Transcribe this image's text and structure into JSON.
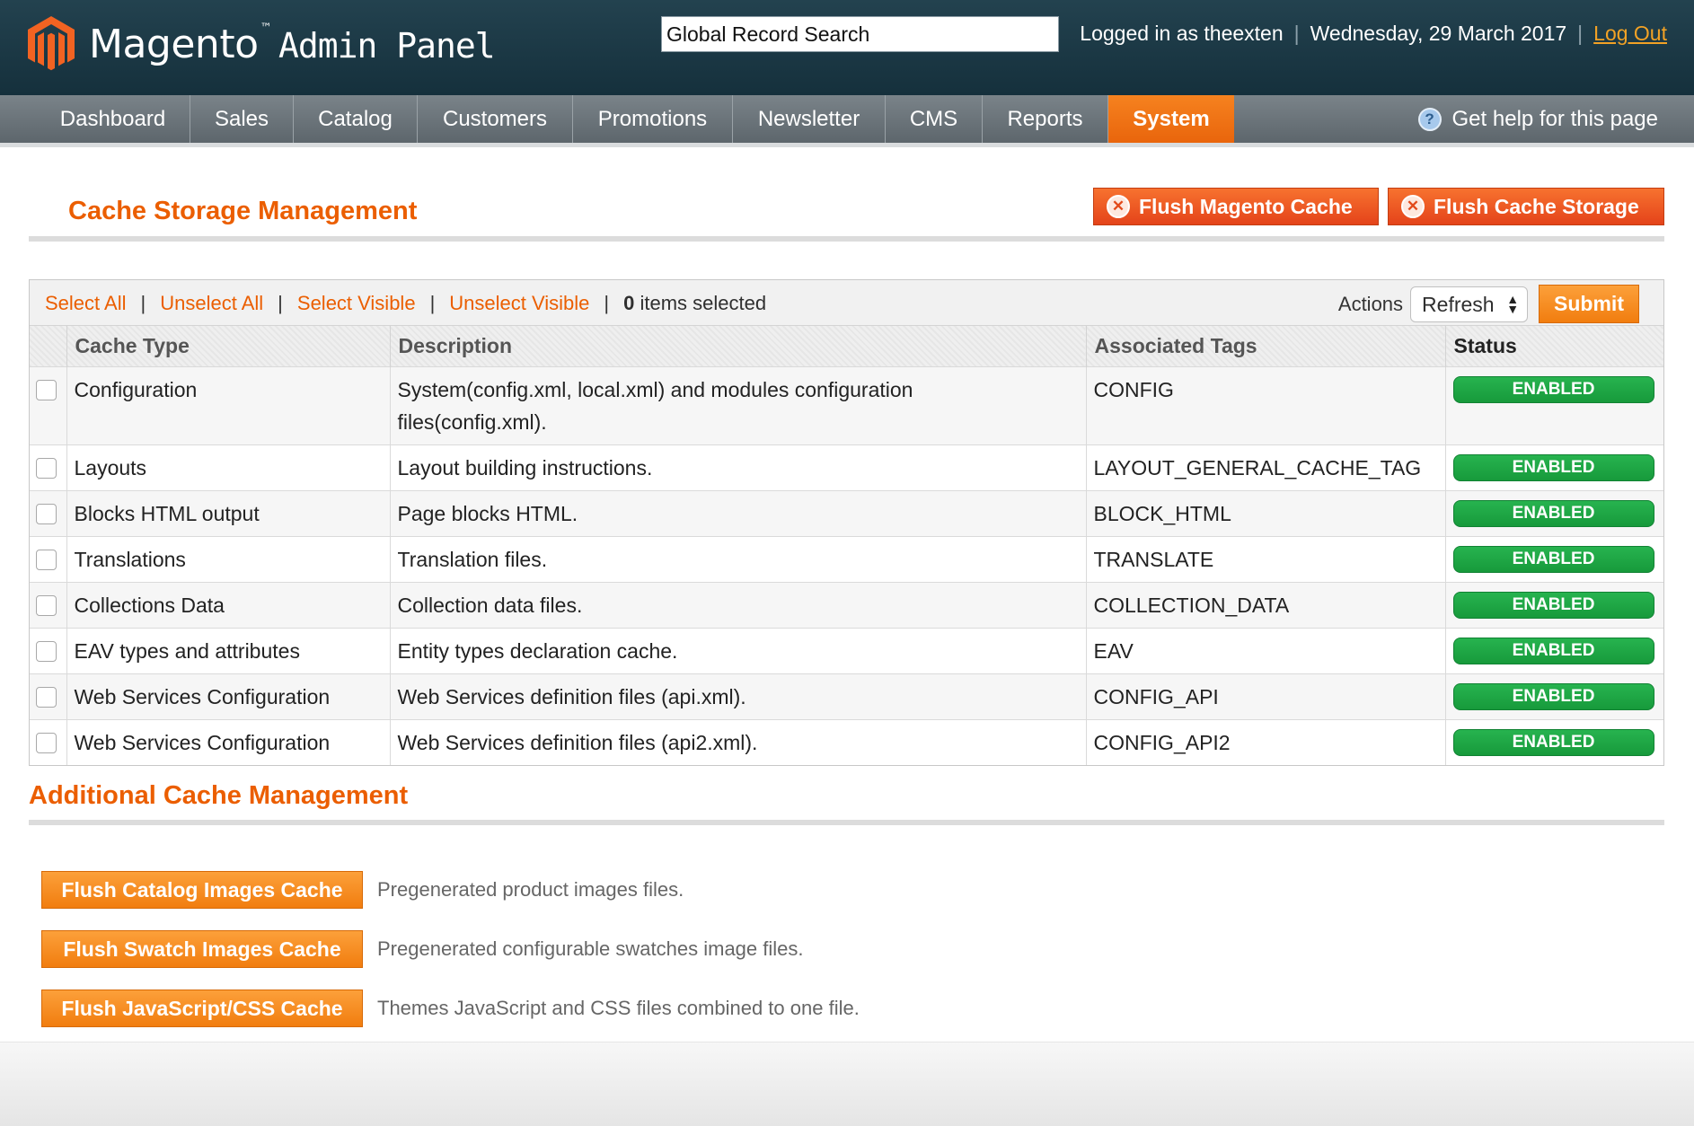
{
  "header": {
    "logo_name": "Magento",
    "logo_tm": "™",
    "logo_sub": "Admin Panel",
    "search_value": "Global Record Search",
    "logged_in": "Logged in as theexten",
    "date": "Wednesday, 29 March 2017",
    "logout": "Log Out"
  },
  "nav": {
    "items": [
      "Dashboard",
      "Sales",
      "Catalog",
      "Customers",
      "Promotions",
      "Newsletter",
      "CMS",
      "Reports",
      "System"
    ],
    "active": "System",
    "help": "Get help for this page"
  },
  "cache_section": {
    "title": "Cache Storage Management",
    "flush_magento": "Flush Magento Cache",
    "flush_storage": "Flush Cache Storage"
  },
  "massaction": {
    "select_all": "Select All",
    "unselect_all": "Unselect All",
    "select_visible": "Select Visible",
    "unselect_visible": "Unselect Visible",
    "count": "0",
    "count_suffix": " items selected",
    "actions_label": "Actions",
    "action_value": "Refresh",
    "submit": "Submit"
  },
  "grid": {
    "columns": [
      "Cache Type",
      "Description",
      "Associated Tags",
      "Status"
    ],
    "rows": [
      {
        "type": "Configuration",
        "description": "System(config.xml, local.xml) and modules configuration files(config.xml).",
        "tags": "CONFIG",
        "status": "ENABLED"
      },
      {
        "type": "Layouts",
        "description": "Layout building instructions.",
        "tags": "LAYOUT_GENERAL_CACHE_TAG",
        "status": "ENABLED"
      },
      {
        "type": "Blocks HTML output",
        "description": "Page blocks HTML.",
        "tags": "BLOCK_HTML",
        "status": "ENABLED"
      },
      {
        "type": "Translations",
        "description": "Translation files.",
        "tags": "TRANSLATE",
        "status": "ENABLED"
      },
      {
        "type": "Collections Data",
        "description": "Collection data files.",
        "tags": "COLLECTION_DATA",
        "status": "ENABLED"
      },
      {
        "type": "EAV types and attributes",
        "description": "Entity types declaration cache.",
        "tags": "EAV",
        "status": "ENABLED"
      },
      {
        "type": "Web Services Configuration",
        "description": "Web Services definition files (api.xml).",
        "tags": "CONFIG_API",
        "status": "ENABLED"
      },
      {
        "type": "Web Services Configuration",
        "description": "Web Services definition files (api2.xml).",
        "tags": "CONFIG_API2",
        "status": "ENABLED"
      }
    ]
  },
  "additional": {
    "title": "Additional Cache Management",
    "items": [
      {
        "button": "Flush Catalog Images Cache",
        "description": "Pregenerated product images files."
      },
      {
        "button": "Flush Swatch Images Cache",
        "description": "Pregenerated configurable swatches image files."
      },
      {
        "button": "Flush JavaScript/CSS Cache",
        "description": "Themes JavaScript and CSS files combined to one file."
      }
    ]
  },
  "colors": {
    "accent": "#eb5e00",
    "header_bg": "#1b3946",
    "nav_bg": "#6b7479",
    "enabled": "#1fa845"
  }
}
